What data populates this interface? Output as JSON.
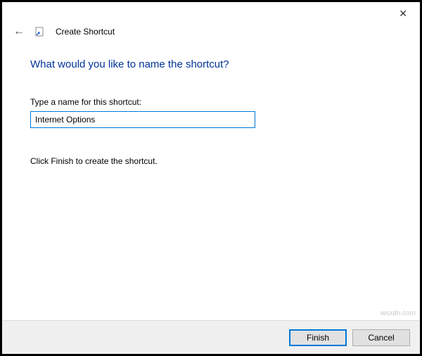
{
  "titlebar": {
    "close_glyph": "✕"
  },
  "header": {
    "back_glyph": "←",
    "title": "Create Shortcut"
  },
  "content": {
    "heading": "What would you like to name the shortcut?",
    "field_label": "Type a name for this shortcut:",
    "field_value": "Internet Options",
    "instruction": "Click Finish to create the shortcut."
  },
  "footer": {
    "primary_label": "Finish",
    "secondary_label": "Cancel"
  },
  "watermark": "wsxdn.com"
}
